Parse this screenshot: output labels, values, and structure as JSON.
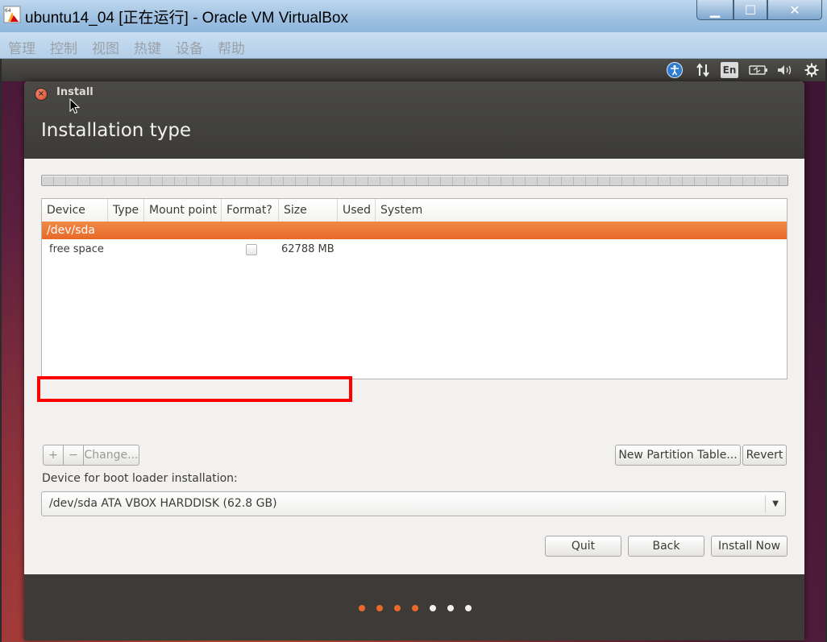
{
  "window": {
    "title": "ubuntu14_04 [正在运行] - Oracle VM VirtualBox",
    "controls": {
      "minimize": "▁",
      "maximize": "☐",
      "close": "✕"
    }
  },
  "menubar": [
    "管理",
    "控制",
    "视图",
    "热键",
    "设备",
    "帮助"
  ],
  "panel": {
    "icons": [
      "accessibility-icon",
      "network-icon",
      "keyboard-layout-icon",
      "battery-icon",
      "volume-icon",
      "settings-gear-icon"
    ],
    "language": "En"
  },
  "installer": {
    "window_title": "Install",
    "heading": "Installation type",
    "table": {
      "columns": [
        "Device",
        "Type",
        "Mount point",
        "Format?",
        "Size",
        "Used",
        "System"
      ],
      "rows": [
        {
          "device": "/dev/sda",
          "selected": true
        },
        {
          "device": "free space",
          "format_checked": false,
          "size": "62788 MB"
        }
      ]
    },
    "buttons": {
      "add": "+",
      "remove": "−",
      "change": "Change...",
      "new_table": "New Partition Table...",
      "revert": "Revert",
      "quit": "Quit",
      "back": "Back",
      "install": "Install Now"
    },
    "bootloader_label": "Device for boot loader installation:",
    "bootloader_device": "/dev/sda  ATA VBOX HARDDISK (62.8 GB)",
    "progress": {
      "total_steps": 7,
      "completed_steps": 4
    }
  },
  "colors": {
    "accent": "#e8692a",
    "highlight_box": "#ff0000",
    "dot_done": "#e8692a",
    "dot_todo": "#f2f1f0"
  }
}
